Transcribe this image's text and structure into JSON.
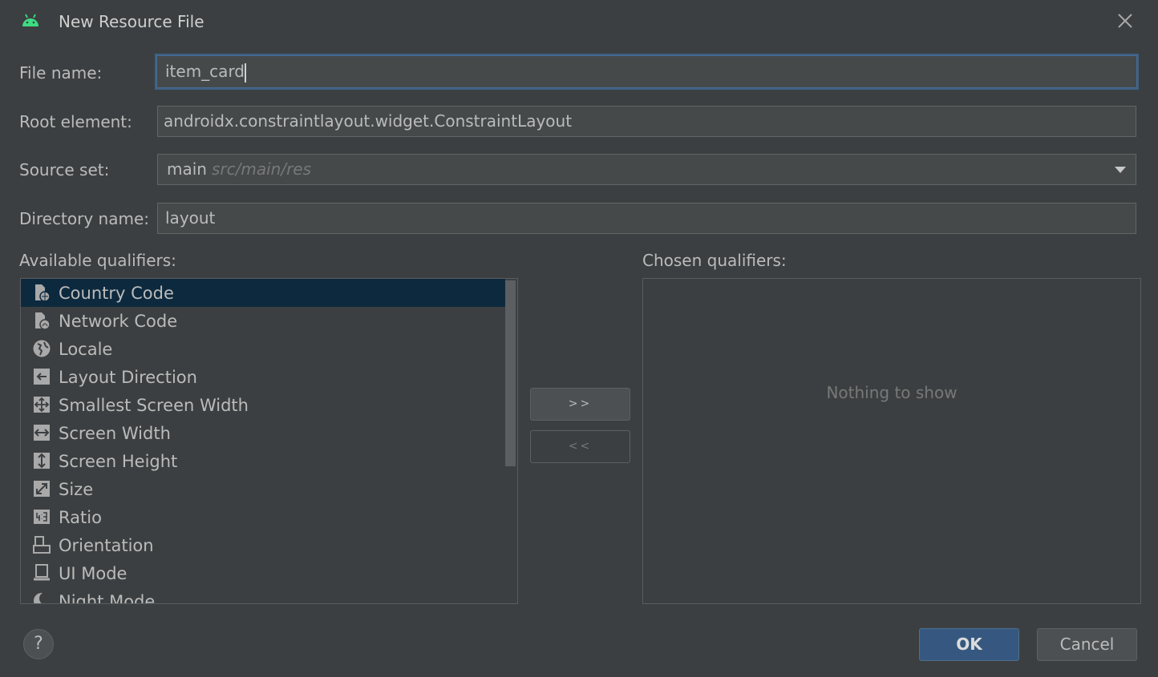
{
  "dialog": {
    "title": "New Resource File"
  },
  "fields": {
    "file_name_label": "File name:",
    "file_name_value": "item_card",
    "root_element_label": "Root element:",
    "root_element_value": "androidx.constraintlayout.widget.ConstraintLayout",
    "source_set_label": "Source set:",
    "source_set_value": "main",
    "source_set_hint": "src/main/res",
    "directory_name_label": "Directory name:",
    "directory_name_value": "layout"
  },
  "qualifiers": {
    "available_label": "Available qualifiers:",
    "chosen_label": "Chosen qualifiers:",
    "empty_text": "Nothing to show",
    "items": [
      {
        "label": "Country Code",
        "icon": "country-code-icon",
        "selected": true
      },
      {
        "label": "Network Code",
        "icon": "network-code-icon",
        "selected": false
      },
      {
        "label": "Locale",
        "icon": "globe-icon",
        "selected": false
      },
      {
        "label": "Layout Direction",
        "icon": "layout-direction-icon",
        "selected": false
      },
      {
        "label": "Smallest Screen Width",
        "icon": "smallest-width-icon",
        "selected": false
      },
      {
        "label": "Screen Width",
        "icon": "screen-width-icon",
        "selected": false
      },
      {
        "label": "Screen Height",
        "icon": "screen-height-icon",
        "selected": false
      },
      {
        "label": "Size",
        "icon": "size-icon",
        "selected": false
      },
      {
        "label": "Ratio",
        "icon": "ratio-icon",
        "selected": false
      },
      {
        "label": "Orientation",
        "icon": "orientation-icon",
        "selected": false
      },
      {
        "label": "UI Mode",
        "icon": "ui-mode-icon",
        "selected": false
      },
      {
        "label": "Night Mode",
        "icon": "night-mode-icon",
        "selected": false
      }
    ]
  },
  "buttons": {
    "add": ">>",
    "remove": "<<",
    "help": "?",
    "ok": "OK",
    "cancel": "Cancel"
  },
  "colors": {
    "background": "#3c3f41",
    "selection": "#0d293e",
    "primary_button": "#365880",
    "focus_border": "#3d6185"
  }
}
